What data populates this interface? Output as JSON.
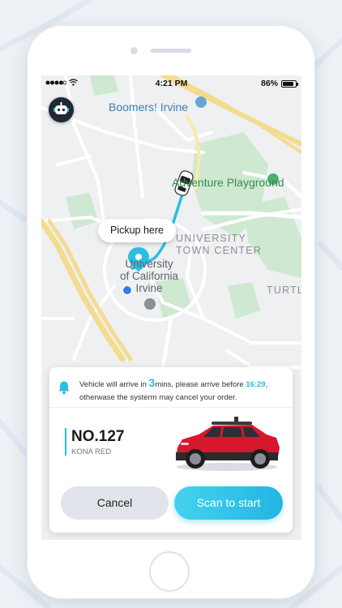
{
  "status_bar": {
    "time": "4:21 PM",
    "battery": "86%",
    "battery_level": 0.86
  },
  "map": {
    "labels": {
      "boomers": "Boomers! Irvine",
      "adventure": "Adventure Playground",
      "university_line1": "UNIVERSITY",
      "university_line2": "TOWN CENTER",
      "uci_line1": "University",
      "uci_line2": "of California",
      "uci_line3": "Irvine",
      "turtle": "TURTL"
    },
    "pickup_bubble": "Pickup here",
    "route_color": "#2bbfe0"
  },
  "card": {
    "notice": {
      "part1": "Vehicle will arrive in ",
      "minutes": "3",
      "part2": "mins,  please arrive before ",
      "time": "16:29",
      "part3": ", otherwase the systerm may cancel your order."
    },
    "vehicle": {
      "plate": "NO.127",
      "model": "KONA RED"
    },
    "cancel_label": "Cancel",
    "scan_label": "Scan to start"
  },
  "colors": {
    "accent": "#26bfe0",
    "car": "#d6182e"
  },
  "icons": [
    "robot-avatar-icon",
    "bell-icon",
    "wifi-icon",
    "battery-icon",
    "location-pin-icon",
    "car-icon"
  ]
}
